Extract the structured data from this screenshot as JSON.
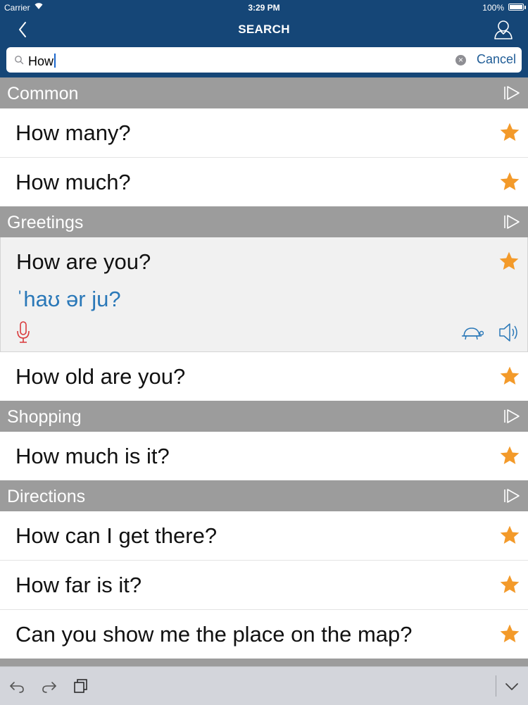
{
  "status_bar": {
    "carrier": "Carrier",
    "time": "3:29 PM",
    "battery": "100%"
  },
  "nav": {
    "title": "SEARCH",
    "back_icon": "chevron-left-icon",
    "user_icon": "user-icon"
  },
  "search": {
    "value": "How",
    "cancel_label": "Cancel"
  },
  "colors": {
    "nav_bg": "#154677",
    "section_bg": "#9c9c9c",
    "star": "#f39a2a",
    "phonetic": "#2a78b8",
    "mic": "#d9393b"
  },
  "sections": [
    {
      "label": "Common",
      "items": [
        "How many?",
        "How much?"
      ]
    },
    {
      "label": "Greetings",
      "expanded_item": {
        "text": "How are you?",
        "phonetic": "ˈhaʊ ər ju?"
      },
      "items": [
        "How old are you?"
      ]
    },
    {
      "label": "Shopping",
      "items": [
        "How much is it?"
      ]
    },
    {
      "label": "Directions",
      "items": [
        "How can I get there?",
        "How far is it?",
        "Can you show me the place on the map?"
      ]
    }
  ]
}
